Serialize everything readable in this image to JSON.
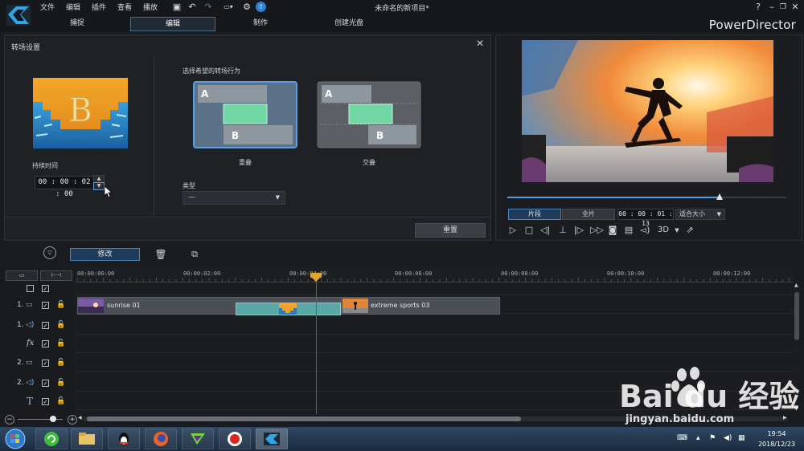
{
  "app": {
    "title": "未命名的新项目*",
    "brand": "PowerDirector",
    "menu": [
      "文件",
      "编辑",
      "插件",
      "查看",
      "播放"
    ],
    "mode_tabs": [
      "捕捉",
      "编辑",
      "制作",
      "创建光盘"
    ],
    "active_tab": "编辑",
    "accent_color": "#4d9de0"
  },
  "transition_panel": {
    "title": "转场设置",
    "duration_label": "持续时间",
    "duration_value": "00 : 00 : 02 : 00",
    "behavior_label": "选择希望的转场行为",
    "options": [
      {
        "label": "重叠",
        "letter_a": "A",
        "letter_b": "B",
        "selected": true
      },
      {
        "label": "交叠",
        "letter_a": "A",
        "letter_b": "B",
        "selected": false
      }
    ],
    "thumb_letter": "B",
    "type_label": "类型",
    "type_value": "—",
    "reset_label": "重置"
  },
  "preview": {
    "btn_clip": "片段",
    "btn_full": "全片",
    "time": "00 : 00 : 01 : 13",
    "zoom": "适合大小",
    "mode_3d": "3D",
    "scrub_position": 0.76
  },
  "timeline": {
    "modify_label": "修改",
    "ruler": [
      "00:00:00:00",
      "00:00:02:00",
      "00:00:04:00",
      "00:00:06:00",
      "00:00:08:00",
      "00:00:10:00",
      "00:00:12:00"
    ],
    "tracks": [
      {
        "num": "",
        "type": "master"
      },
      {
        "num": "1.",
        "type": "video"
      },
      {
        "num": "1.",
        "type": "audio"
      },
      {
        "num": "",
        "type": "fx"
      },
      {
        "num": "2.",
        "type": "video"
      },
      {
        "num": "2.",
        "type": "audio"
      },
      {
        "num": "",
        "type": "title"
      }
    ],
    "clips": [
      {
        "name": "sunrise 01"
      },
      {
        "name": "extreme sports 03"
      }
    ]
  },
  "taskbar": {
    "time": "19:54",
    "date": "2018/12/23"
  },
  "watermark": {
    "text": "Bai du 经验",
    "url": "jingyan.baidu.com"
  }
}
